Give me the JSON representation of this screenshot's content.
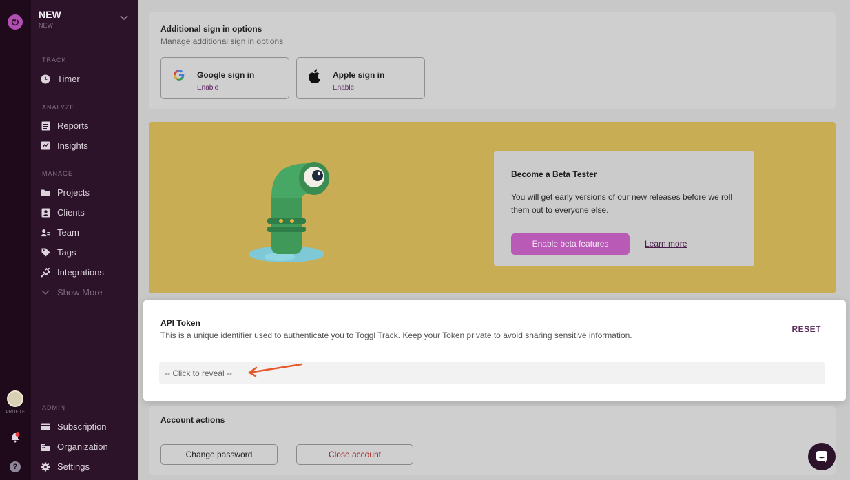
{
  "rail": {
    "profile_label": "PROFILE",
    "help_glyph": "?"
  },
  "workspace": {
    "name": "NEW",
    "subtitle": "NEW"
  },
  "sidebar": {
    "track_label": "TRACK",
    "timer": "Timer",
    "analyze_label": "ANALYZE",
    "reports": "Reports",
    "insights": "Insights",
    "manage_label": "MANAGE",
    "projects": "Projects",
    "clients": "Clients",
    "team": "Team",
    "tags": "Tags",
    "integrations": "Integrations",
    "show_more": "Show More",
    "admin_label": "ADMIN",
    "subscription": "Subscription",
    "organization": "Organization",
    "settings": "Settings"
  },
  "signin": {
    "title": "Additional sign in options",
    "subtitle": "Manage additional sign in options",
    "providers": [
      {
        "name": "Google sign in",
        "action": "Enable",
        "icon": "google-icon"
      },
      {
        "name": "Apple sign in",
        "action": "Enable",
        "icon": "apple-icon"
      }
    ]
  },
  "beta": {
    "title": "Become a Beta Tester",
    "text": "You will get early versions of our new releases before we roll them out to everyone else.",
    "button": "Enable beta features",
    "link": "Learn more"
  },
  "api": {
    "title": "API Token",
    "description": "This is a unique identifier used to authenticate you to Toggl Track. Keep your Token private to avoid sharing sensitive information.",
    "reset": "RESET",
    "reveal": "-- Click to reveal --"
  },
  "account": {
    "title": "Account actions",
    "change_password": "Change password",
    "close_account": "Close account"
  },
  "colors": {
    "accent": "#b95ab7",
    "sidebar": "#2c1329",
    "rail": "#1f0a1c",
    "beta_bg": "#c9ad55",
    "arrow": "#e8582a"
  }
}
